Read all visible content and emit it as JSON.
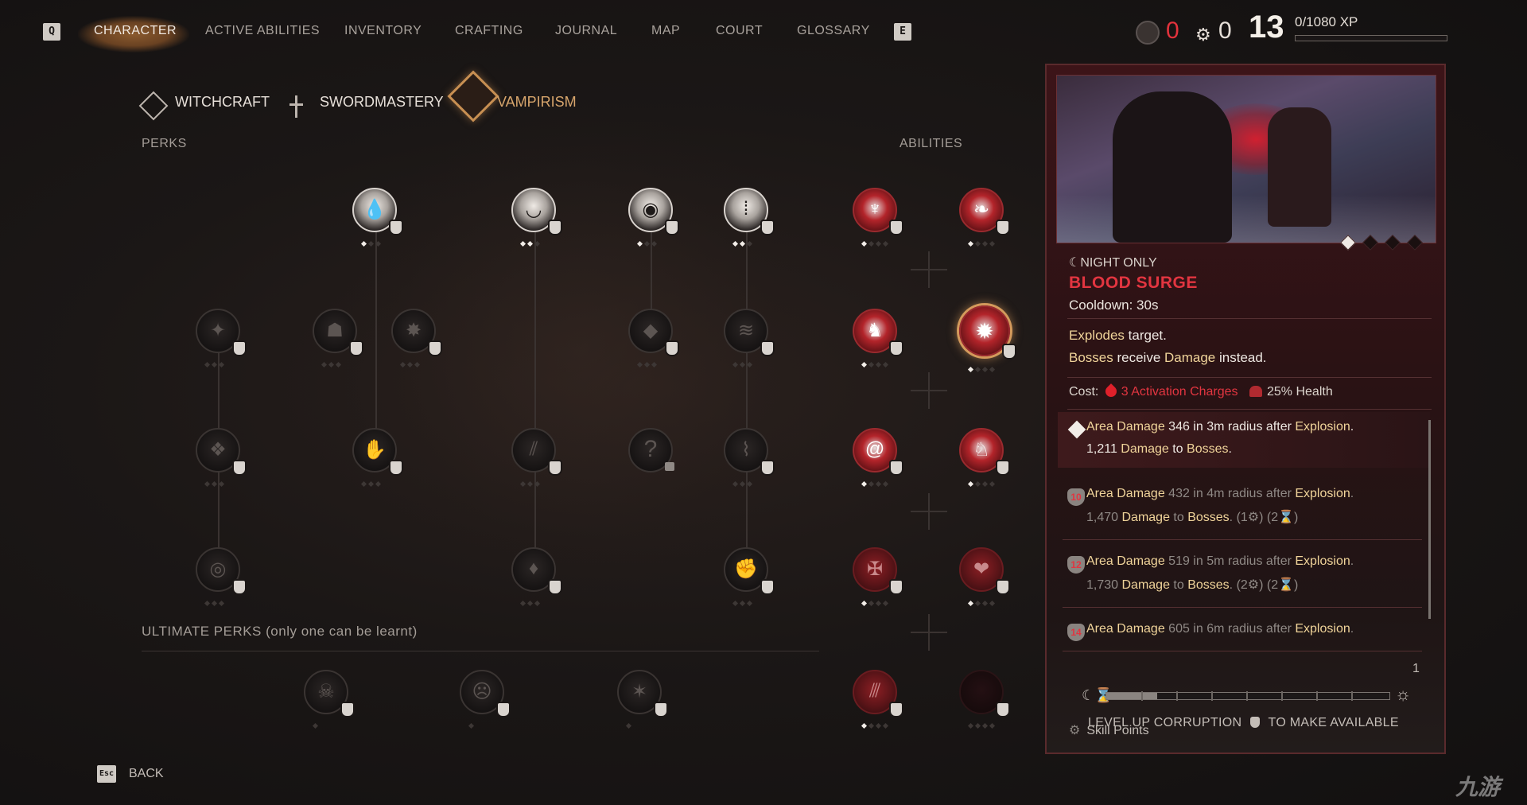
{
  "nav": {
    "left_key": "Q",
    "right_key": "E",
    "tabs": [
      "CHARACTER",
      "ACTIVE ABILITIES",
      "INVENTORY",
      "CRAFTING",
      "JOURNAL",
      "MAP",
      "COURT",
      "GLOSSARY"
    ],
    "active_tab": "CHARACTER"
  },
  "status": {
    "currency_red": "0",
    "currency_gear": "0",
    "level": "13",
    "xp": "0/1080 XP",
    "xp_progress": 0.0
  },
  "subtabs": {
    "items": [
      "WITCHCRAFT",
      "SWORDMASTERY",
      "VAMPIRISM"
    ],
    "active": "VAMPIRISM"
  },
  "sections": {
    "perks": "PERKS",
    "abilities": "ABILITIES",
    "ultimate": "ULTIMATE PERKS (only one can be learnt)"
  },
  "locked_node_glyph": "?",
  "detail": {
    "time_of_day": "☾NIGHT ONLY",
    "title": "BLOOD SURGE",
    "cooldown": "Cooldown: 30s",
    "desc1_a": "Explodes",
    "desc1_b": " target.",
    "desc2_a": "Bosses",
    "desc2_b": " receive ",
    "desc2_c": "Damage",
    "desc2_d": " instead.",
    "cost_label": "Cost:",
    "cost_charges": "3 Activation Charges",
    "cost_health": "25% Health",
    "screenshot_pages": 4,
    "screenshot_page_active": 1,
    "tiers": [
      {
        "badge": "",
        "l1a": "Area Damage",
        "l1b": " 346 in 3m radius after ",
        "l1c": "Explosion",
        "l1d": ".",
        "l2a": "1,211 ",
        "l2b": "Damage",
        "l2c": " to ",
        "l2d": "Bosses",
        "l2e": "."
      },
      {
        "badge": "10",
        "l1a": "Area Damage",
        "l1b": " 432 in 4m radius after ",
        "l1c": "Explosion",
        "l1d": ".",
        "l2a": "1,470 ",
        "l2b": "Damage",
        "l2c": " to ",
        "l2d": "Bosses",
        "l2e": ".  (1⚙) (2⌛)"
      },
      {
        "badge": "12",
        "l1a": "Area Damage",
        "l1b": " 519 in 5m radius after ",
        "l1c": "Explosion",
        "l1d": ".",
        "l2a": "1,730 ",
        "l2b": "Damage",
        "l2c": " to ",
        "l2d": "Bosses",
        "l2e": ".  (2⚙) (2⌛)"
      },
      {
        "badge": "14",
        "l1a": "Area Damage",
        "l1b": " 605 in 6m radius after ",
        "l1c": "Explosion",
        "l1d": ".",
        "l2a": "",
        "l2b": "",
        "l2c": "",
        "l2d": "",
        "l2e": ""
      }
    ],
    "skill_points_label": "Skill Points",
    "skill_points": "1",
    "corruption_progress": 0.18,
    "level_up_a": "LEVEL UP CORRUPTION",
    "level_up_b": "TO MAKE AVAILABLE"
  },
  "footer": {
    "esc_key": "Esc",
    "back": "BACK"
  },
  "watermark": "九游"
}
